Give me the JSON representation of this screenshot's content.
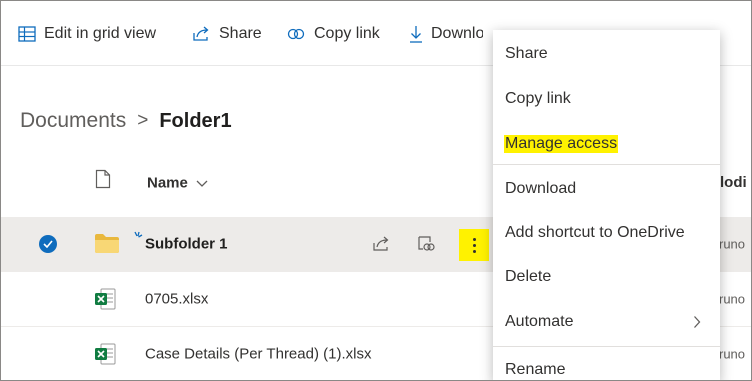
{
  "command_bar": {
    "edit_grid_label": "Edit in grid view",
    "share_label": "Share",
    "copy_link_label": "Copy link",
    "download_label": "Downlo"
  },
  "breadcrumb": {
    "root": "Documents",
    "separator": ">",
    "current": "Folder1"
  },
  "list_header": {
    "name_label": "Name",
    "modified_label": "lodi"
  },
  "files": [
    {
      "name": "Subfolder 1",
      "type": "folder",
      "selected": true,
      "modified_by": "runo"
    },
    {
      "name": "0705.xlsx",
      "type": "excel",
      "selected": false,
      "modified_by": "runo"
    },
    {
      "name": "Case Details (Per Thread) (1).xlsx",
      "type": "excel",
      "selected": false,
      "modified_by": "runo"
    }
  ],
  "context_menu": {
    "items": [
      {
        "label": "Share"
      },
      {
        "label": "Copy link"
      },
      {
        "label": "Manage access",
        "highlighted": true
      },
      {
        "label": "Download"
      },
      {
        "label": "Add shortcut to OneDrive"
      },
      {
        "label": "Delete"
      },
      {
        "label": "Automate",
        "has_submenu": true
      },
      {
        "label": "Rename"
      }
    ]
  },
  "colors": {
    "accent": "#0f6cbd",
    "highlight": "#fff200",
    "selected_row": "#edebe9",
    "folder": "#f8d775",
    "excel": "#107c41"
  },
  "icons": {
    "edit_grid": "grid-icon",
    "share": "share-icon",
    "copy_link": "link-icon",
    "download": "download-icon",
    "file_type": "file-icon",
    "sort": "chevron-down-icon",
    "selected": "checkmark-icon",
    "folder": "folder-icon",
    "excel": "excel-icon",
    "more": "more-vertical-icon",
    "submenu": "chevron-right-icon"
  }
}
